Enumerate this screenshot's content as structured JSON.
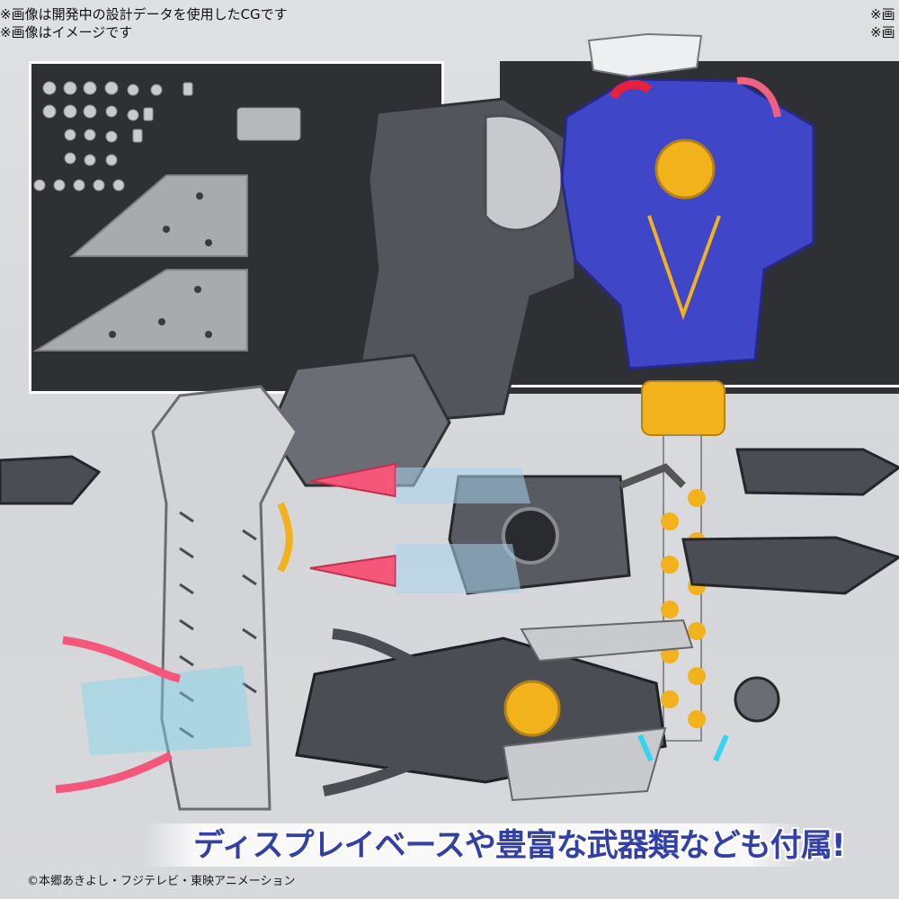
{
  "notes": {
    "top_line1": "※画像は開発中の設計データを使用したCGです",
    "top_line2": "※画像はイメージです",
    "top_right_line1": "※画",
    "top_right_line2": "※画"
  },
  "banner": {
    "text": "ディスプレイベースや豊富な武器類なども付属!"
  },
  "copyright": "©本郷あきよし・フジテレビ・東映アニメーション",
  "colors": {
    "background": "#d7d8db",
    "inset_background": "#2f3033",
    "blue_weapon": "#4046c8",
    "gold_accent": "#f2b21c",
    "pink_accent": "#f4577a",
    "cyan_accent": "#35d4f0",
    "gunmetal": "#4a4d54",
    "banner_text": "#3340a8"
  }
}
